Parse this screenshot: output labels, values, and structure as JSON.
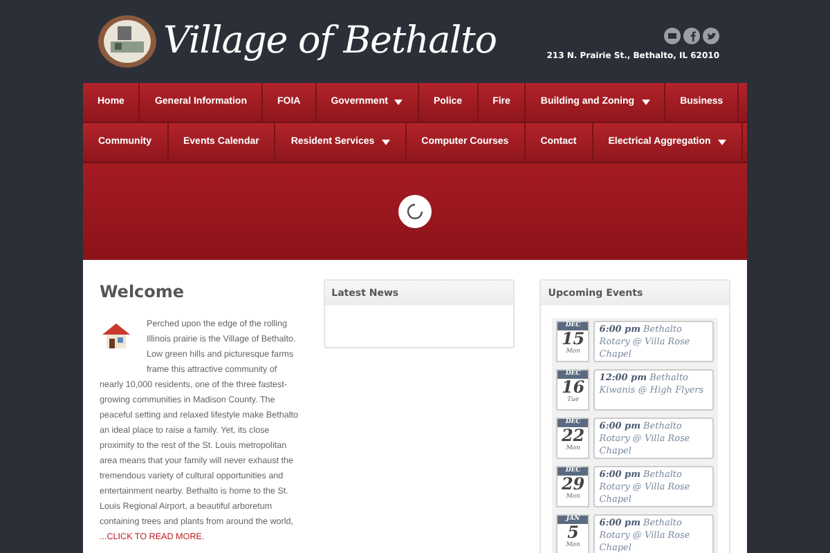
{
  "header": {
    "site_title": "Village of Bethalto",
    "address": "213 N. Prairie St., Bethalto, IL 62010"
  },
  "nav_rows": [
    [
      {
        "label": "Home",
        "dropdown": false
      },
      {
        "label": "General Information",
        "dropdown": false
      },
      {
        "label": "FOIA",
        "dropdown": false
      },
      {
        "label": "Government",
        "dropdown": true
      },
      {
        "label": "Police",
        "dropdown": false
      },
      {
        "label": "Fire",
        "dropdown": false
      },
      {
        "label": "Building and Zoning",
        "dropdown": true
      },
      {
        "label": "Business",
        "dropdown": false
      }
    ],
    [
      {
        "label": "Community",
        "dropdown": false
      },
      {
        "label": "Events Calendar",
        "dropdown": false
      },
      {
        "label": "Resident Services",
        "dropdown": true
      },
      {
        "label": "Computer Courses",
        "dropdown": false
      },
      {
        "label": "Contact",
        "dropdown": false
      },
      {
        "label": "Electrical Aggregation",
        "dropdown": true
      }
    ]
  ],
  "welcome": {
    "title": "Welcome",
    "text_beside_icon": "Perched upon the edge of the rolling Illinois prairie is the Village of Bethalto. Low green hills and picturesque farms frame this attractive community of",
    "text": "nearly 10,000 residents, one of the three fastest-growing communities in Madison County. The peaceful setting and relaxed lifestyle make Bethalto an ideal place to raise a family. Yet, its close proximity to the rest of the St. Louis metropolitan area means that your family will never exhaust the tremendous variety of cultural opportunities and entertainment nearby. Bethalto is home to the St. Louis Regional Airport, a beautiful arboretum containing trees and plants from around the world,",
    "link": "...CLICK TO READ MORE."
  },
  "latest_news": {
    "title": "Latest News"
  },
  "upcoming_events": {
    "title": "Upcoming Events",
    "events": [
      {
        "month": "DEC",
        "day": "15",
        "weekday": "Mon",
        "time": "6:00 pm",
        "title": "Bethalto Rotary @ Villa Rose Chapel"
      },
      {
        "month": "DEC",
        "day": "16",
        "weekday": "Tue",
        "time": "12:00 pm",
        "title": "Bethalto Kiwanis @ High Flyers"
      },
      {
        "month": "DEC",
        "day": "22",
        "weekday": "Mon",
        "time": "6:00 pm",
        "title": "Bethalto Rotary @ Villa Rose Chapel"
      },
      {
        "month": "DEC",
        "day": "29",
        "weekday": "Mon",
        "time": "6:00 pm",
        "title": "Bethalto Rotary @ Villa Rose Chapel"
      },
      {
        "month": "JAN",
        "day": "5",
        "weekday": "Mon",
        "time": "6:00 pm",
        "title": "Bethalto Rotary @ Villa Rose Chapel"
      }
    ]
  }
}
